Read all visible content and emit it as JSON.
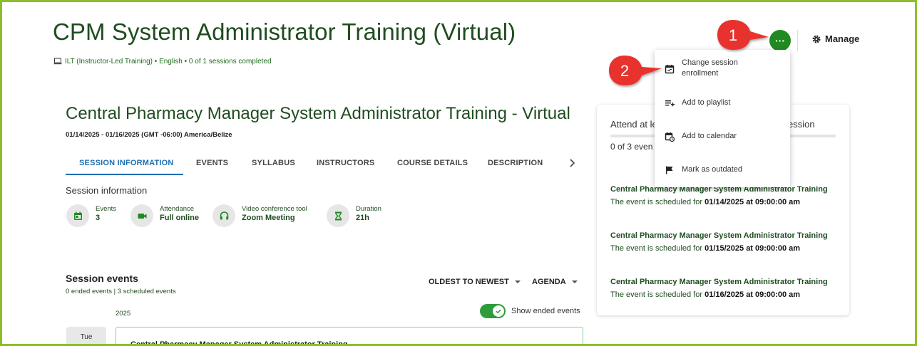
{
  "header": {
    "title": "CPM System Administrator Training (Virtual)",
    "meta": "ILT (Instructor-Led Training) • English • 0 of 1 sessions completed",
    "more_label": "···",
    "manage_label": "Manage"
  },
  "callouts": [
    {
      "number": "1"
    },
    {
      "number": "2"
    }
  ],
  "menu": {
    "items": [
      {
        "label_line1": "Change session",
        "label_line2": "enrollment",
        "icon": "calendar-change-icon"
      },
      {
        "label_line1": "Add to playlist",
        "label_line2": "",
        "icon": "playlist-add-icon"
      },
      {
        "label_line1": "Add to calendar",
        "label_line2": "",
        "icon": "calendar-add-icon"
      },
      {
        "label_line1": "Mark as outdated",
        "label_line2": "",
        "icon": "flag-icon"
      }
    ]
  },
  "course": {
    "title": "Central Pharmacy Manager System Administrator Training - Virtual",
    "dates": "01/14/2025 - 01/16/2025 (GMT -06:00) America/Belize"
  },
  "tabs": [
    {
      "label": "Session information",
      "active": true
    },
    {
      "label": "Events",
      "active": false
    },
    {
      "label": "Syllabus",
      "active": false
    },
    {
      "label": "Instructors",
      "active": false
    },
    {
      "label": "Course details",
      "active": false
    },
    {
      "label": "Description",
      "active": false
    }
  ],
  "session_info": {
    "title": "Session information",
    "items": [
      {
        "label": "Events",
        "value": "3",
        "icon": "calendar-icon"
      },
      {
        "label": "Attendance",
        "value": "Full online",
        "icon": "video-camera-icon"
      },
      {
        "label": "Video conference tool",
        "value": "Zoom Meeting",
        "icon": "headset-icon"
      },
      {
        "label": "Duration",
        "value": "21h",
        "icon": "hourglass-icon"
      }
    ]
  },
  "session_events": {
    "title": "Session events",
    "subtitle": "0 ended events | 3 scheduled events",
    "sort_label": "OLDEST TO NEWEST",
    "view_label": "AGENDA",
    "year": "2025",
    "toggle_label": "Show ended events",
    "toggle_on": true,
    "day_label": "Tue",
    "first_event_title": "Central Pharmacy Manager System Administrator Training"
  },
  "side_panel": {
    "heading_left": "Attend at le",
    "heading_right": "ession",
    "count": "0 of 3 even",
    "events": [
      {
        "title": "Central Pharmacy Manager System Administrator Training",
        "prefix": "The event is scheduled for ",
        "datetime": "01/14/2025 at 09:00:00 am"
      },
      {
        "title": "Central Pharmacy Manager System Administrator Training",
        "prefix": "The event is scheduled for ",
        "datetime": "01/15/2025 at 09:00:00 am"
      },
      {
        "title": "Central Pharmacy Manager System Administrator Training",
        "prefix": "The event is scheduled for ",
        "datetime": "01/16/2025 at 09:00:00 am"
      }
    ]
  },
  "colors": {
    "brand_green": "#1f8a1f",
    "title_green": "#1f4d20",
    "tab_blue": "#1f6fb0",
    "callout_red": "#e8332f",
    "frame_green": "#8cbf26"
  }
}
